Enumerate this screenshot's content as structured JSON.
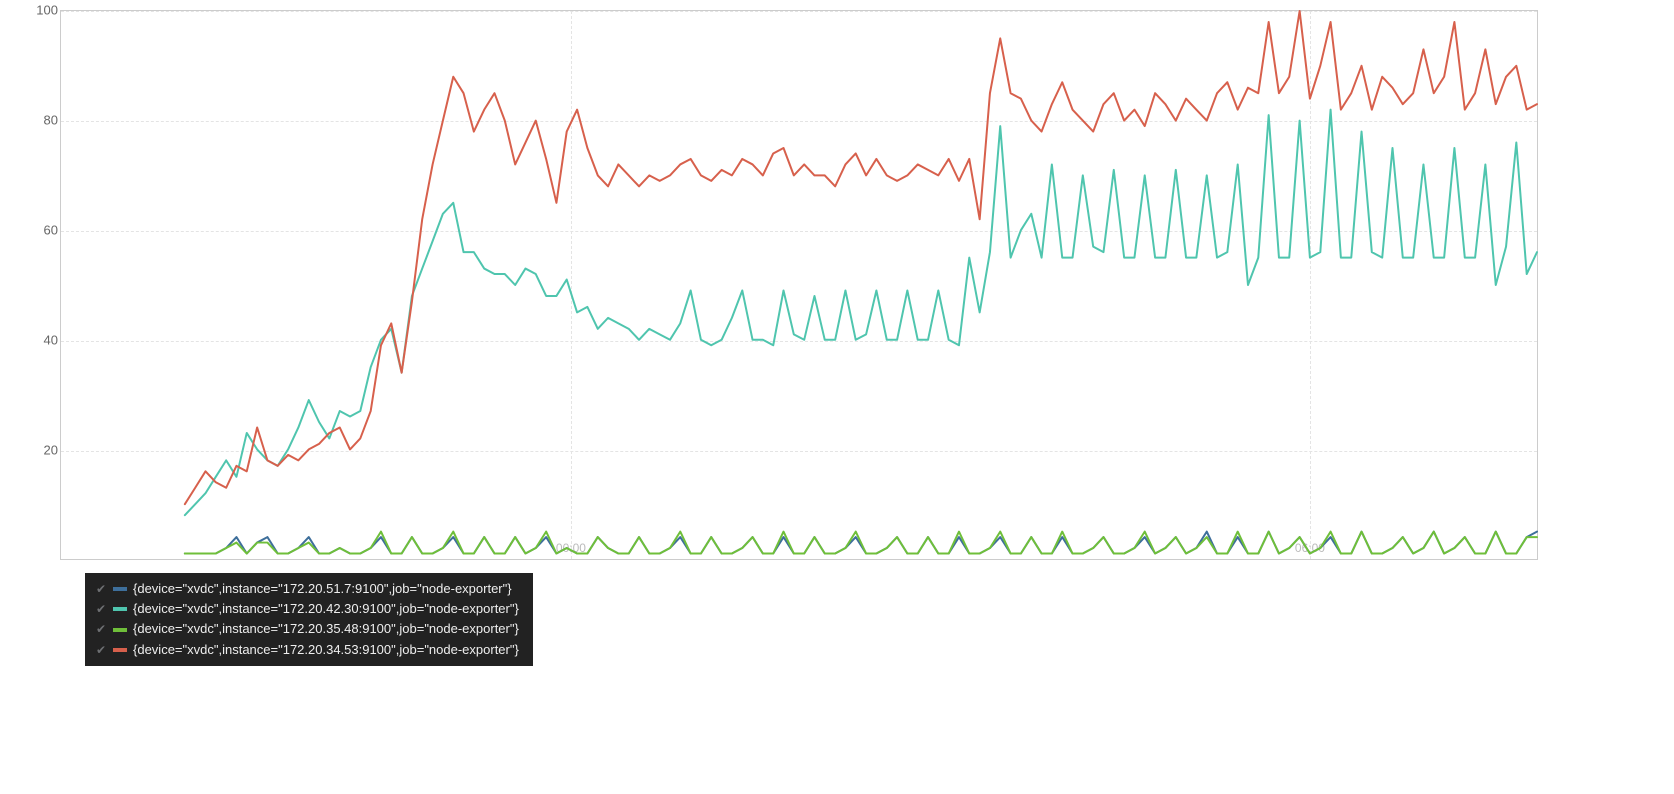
{
  "chart_data": {
    "type": "line",
    "ylim": [
      0,
      100
    ],
    "yticks": [
      20,
      40,
      60,
      80,
      100
    ],
    "x_count": 144,
    "xgrid_positions": [
      0.345,
      0.845
    ],
    "xlabels": [
      "00:00",
      "06:00"
    ],
    "series": [
      {
        "name": "{device=\"xvdc\",instance=\"172.20.51.7:9100\",job=\"node-exporter\"}",
        "color": "#3e6f9b",
        "start_index": 12,
        "values": [
          1,
          1,
          1,
          1,
          2,
          4,
          1,
          3,
          4,
          1,
          1,
          2,
          4,
          1,
          1,
          2,
          1,
          1,
          2,
          4,
          1,
          1,
          4,
          1,
          1,
          2,
          4,
          1,
          1,
          4,
          1,
          1,
          4,
          1,
          2,
          4,
          1,
          2,
          1,
          1,
          4,
          2,
          1,
          1,
          4,
          1,
          1,
          2,
          4,
          1,
          1,
          4,
          1,
          1,
          2,
          4,
          1,
          1,
          4,
          1,
          1,
          4,
          1,
          1,
          2,
          4,
          1,
          1,
          2,
          4,
          1,
          1,
          4,
          1,
          1,
          4,
          1,
          1,
          2,
          4,
          1,
          1,
          4,
          1,
          1,
          4,
          1,
          1,
          2,
          4,
          1,
          1,
          2,
          4,
          1,
          2,
          4,
          1,
          2,
          5,
          1,
          1,
          4,
          1,
          1,
          5,
          1,
          2,
          4,
          1,
          2,
          4,
          1,
          1,
          5,
          1,
          1,
          2,
          4,
          1,
          2,
          5,
          1,
          2,
          4,
          1,
          1,
          5,
          1,
          1,
          4,
          5
        ]
      },
      {
        "name": "{device=\"xvdc\",instance=\"172.20.42.30:9100\",job=\"node-exporter\"}",
        "color": "#4fc5ae",
        "start_index": 12,
        "values": [
          8,
          10,
          12,
          15,
          18,
          15,
          23,
          20,
          18,
          17,
          20,
          24,
          29,
          25,
          22,
          27,
          26,
          27,
          35,
          40,
          42,
          34,
          48,
          53,
          58,
          63,
          65,
          56,
          56,
          53,
          52,
          52,
          50,
          53,
          52,
          48,
          48,
          51,
          45,
          46,
          42,
          44,
          43,
          42,
          40,
          42,
          41,
          40,
          43,
          49,
          40,
          39,
          40,
          44,
          49,
          40,
          40,
          39,
          49,
          41,
          40,
          48,
          40,
          40,
          49,
          40,
          41,
          49,
          40,
          40,
          49,
          40,
          40,
          49,
          40,
          39,
          55,
          45,
          56,
          79,
          55,
          60,
          63,
          55,
          72,
          55,
          55,
          70,
          57,
          56,
          71,
          55,
          55,
          70,
          55,
          55,
          71,
          55,
          55,
          70,
          55,
          56,
          72,
          50,
          55,
          81,
          55,
          55,
          80,
          55,
          56,
          82,
          55,
          55,
          78,
          56,
          55,
          75,
          55,
          55,
          72,
          55,
          55,
          75,
          55,
          55,
          72,
          50,
          57,
          76,
          52,
          56
        ]
      },
      {
        "name": "{device=\"xvdc\",instance=\"172.20.35.48:9100\",job=\"node-exporter\"}",
        "color": "#6fbf3a",
        "start_index": 12,
        "values": [
          1,
          1,
          1,
          1,
          2,
          3,
          1,
          3,
          3,
          1,
          1,
          2,
          3,
          1,
          1,
          2,
          1,
          1,
          2,
          5,
          1,
          1,
          4,
          1,
          1,
          2,
          5,
          1,
          1,
          4,
          1,
          1,
          4,
          1,
          2,
          5,
          1,
          2,
          1,
          1,
          4,
          2,
          1,
          1,
          4,
          1,
          1,
          2,
          5,
          1,
          1,
          4,
          1,
          1,
          2,
          4,
          1,
          1,
          5,
          1,
          1,
          4,
          1,
          1,
          2,
          5,
          1,
          1,
          2,
          4,
          1,
          1,
          4,
          1,
          1,
          5,
          1,
          1,
          2,
          5,
          1,
          1,
          4,
          1,
          1,
          5,
          1,
          1,
          2,
          4,
          1,
          1,
          2,
          5,
          1,
          2,
          4,
          1,
          2,
          4,
          1,
          1,
          5,
          1,
          1,
          5,
          1,
          2,
          4,
          1,
          2,
          5,
          1,
          1,
          5,
          1,
          1,
          2,
          4,
          1,
          2,
          5,
          1,
          2,
          4,
          1,
          1,
          5,
          1,
          1,
          4,
          4
        ]
      },
      {
        "name": "{device=\"xvdc\",instance=\"172.20.34.53:9100\",job=\"node-exporter\"}",
        "color": "#d7604c",
        "start_index": 12,
        "values": [
          10,
          13,
          16,
          14,
          13,
          17,
          16,
          24,
          18,
          17,
          19,
          18,
          20,
          21,
          23,
          24,
          20,
          22,
          27,
          39,
          43,
          34,
          47,
          62,
          72,
          80,
          88,
          85,
          78,
          82,
          85,
          80,
          72,
          76,
          80,
          73,
          65,
          78,
          82,
          75,
          70,
          68,
          72,
          70,
          68,
          70,
          69,
          70,
          72,
          73,
          70,
          69,
          71,
          70,
          73,
          72,
          70,
          74,
          75,
          70,
          72,
          70,
          70,
          68,
          72,
          74,
          70,
          73,
          70,
          69,
          70,
          72,
          71,
          70,
          73,
          69,
          73,
          62,
          85,
          95,
          85,
          84,
          80,
          78,
          83,
          87,
          82,
          80,
          78,
          83,
          85,
          80,
          82,
          79,
          85,
          83,
          80,
          84,
          82,
          80,
          85,
          87,
          82,
          86,
          85,
          98,
          85,
          88,
          100,
          84,
          90,
          98,
          82,
          85,
          90,
          82,
          88,
          86,
          83,
          85,
          93,
          85,
          88,
          98,
          82,
          85,
          93,
          83,
          88,
          90,
          82,
          83
        ]
      }
    ]
  },
  "legend": {
    "items": [
      {
        "label": "{device=\"xvdc\",instance=\"172.20.51.7:9100\",job=\"node-exporter\"}",
        "color": "#3e6f9b"
      },
      {
        "label": "{device=\"xvdc\",instance=\"172.20.42.30:9100\",job=\"node-exporter\"}",
        "color": "#4fc5ae"
      },
      {
        "label": "{device=\"xvdc\",instance=\"172.20.35.48:9100\",job=\"node-exporter\"}",
        "color": "#6fbf3a"
      },
      {
        "label": "{device=\"xvdc\",instance=\"172.20.34.53:9100\",job=\"node-exporter\"}",
        "color": "#d7604c"
      }
    ]
  }
}
